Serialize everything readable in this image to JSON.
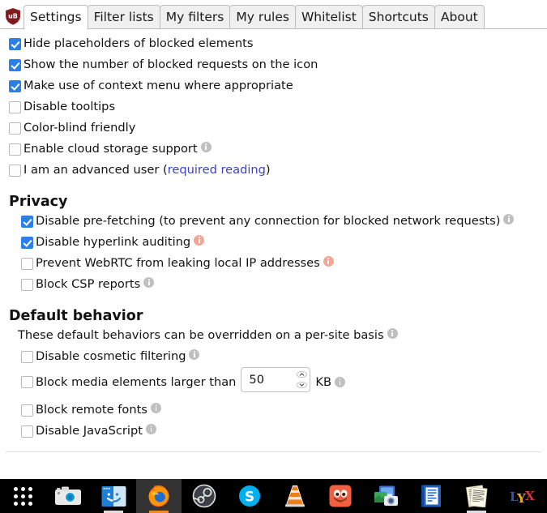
{
  "app": {
    "logo_icon": "ublock-shield-icon",
    "logo_text": "uB",
    "logo_color": "#8f1f22"
  },
  "tabs": [
    {
      "label": "Settings",
      "active": true
    },
    {
      "label": "Filter lists",
      "active": false
    },
    {
      "label": "My filters",
      "active": false
    },
    {
      "label": "My rules",
      "active": false
    },
    {
      "label": "Whitelist",
      "active": false
    },
    {
      "label": "Shortcuts",
      "active": false
    },
    {
      "label": "About",
      "active": false
    }
  ],
  "general": {
    "options": [
      {
        "label": "Hide placeholders of blocked elements",
        "checked": true,
        "info": "none"
      },
      {
        "label": "Show the number of blocked requests on the icon",
        "checked": true,
        "info": "none"
      },
      {
        "label": "Make use of context menu where appropriate",
        "checked": true,
        "info": "none"
      },
      {
        "label": "Disable tooltips",
        "checked": false,
        "info": "none"
      },
      {
        "label": "Color-blind friendly",
        "checked": false,
        "info": "none"
      },
      {
        "label": "Enable cloud storage support",
        "checked": false,
        "info": "gray"
      }
    ],
    "advanced_user": {
      "prefix": "I am an advanced user (",
      "link_text": "required reading",
      "suffix": ")",
      "checked": false
    }
  },
  "privacy": {
    "heading": "Privacy",
    "options": [
      {
        "label": "Disable pre-fetching (to prevent any connection for blocked network requests)",
        "checked": true,
        "info": "gray"
      },
      {
        "label": "Disable hyperlink auditing",
        "checked": true,
        "info": "warn"
      },
      {
        "label": "Prevent WebRTC from leaking local IP addresses",
        "checked": false,
        "info": "warn"
      },
      {
        "label": "Block CSP reports",
        "checked": false,
        "info": "gray"
      }
    ]
  },
  "default_behavior": {
    "heading": "Default behavior",
    "note": "These default behaviors can be overridden on a per-site basis",
    "note_info": "gray",
    "options_before": [
      {
        "label": "Disable cosmetic filtering",
        "checked": false,
        "info": "gray"
      }
    ],
    "media": {
      "checked": false,
      "label_before": "Block media elements larger than",
      "value": "50",
      "unit": "KB",
      "info": "gray",
      "spin_up_icon": "chevron-up-icon",
      "spin_down_icon": "chevron-down-icon"
    },
    "options_after": [
      {
        "label": "Block remote fonts",
        "checked": false,
        "info": "gray"
      },
      {
        "label": "Disable JavaScript",
        "checked": false,
        "info": "gray"
      }
    ]
  },
  "taskbar": {
    "items": [
      {
        "name": "app-grid-icon",
        "label": "Show Applications",
        "state": "idle"
      },
      {
        "name": "camera-screenshot-icon",
        "label": "Screenshot",
        "state": "idle"
      },
      {
        "name": "file-manager-icon",
        "label": "Files",
        "state": "running"
      },
      {
        "name": "firefox-icon",
        "label": "Firefox",
        "state": "active"
      },
      {
        "name": "steam-icon",
        "label": "Steam",
        "state": "idle"
      },
      {
        "name": "skype-icon",
        "label": "Skype",
        "state": "idle"
      },
      {
        "name": "vlc-icon",
        "label": "VLC media player",
        "state": "idle"
      },
      {
        "name": "gimp-icon",
        "label": "GIMP",
        "state": "idle"
      },
      {
        "name": "image-viewer-icon",
        "label": "Photos",
        "state": "idle"
      },
      {
        "name": "document-editor-icon",
        "label": "Writer",
        "state": "idle"
      },
      {
        "name": "text-documents-icon",
        "label": "Documents",
        "state": "running"
      },
      {
        "name": "lyx-icon",
        "label": "LyX",
        "state": "idle"
      }
    ]
  }
}
